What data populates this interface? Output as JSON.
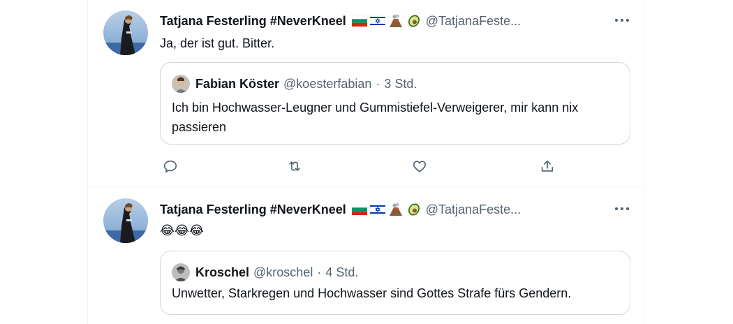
{
  "tweets": [
    {
      "name": "Tatjana Festerling #NeverKneel",
      "handle": "@TatjanaFeste...",
      "text": "Ja, der ist gut. Bitter.",
      "quote": {
        "name": "Fabian Köster",
        "handle": "@koesterfabian",
        "sep": "·",
        "time": "3 Std.",
        "text": "Ich bin Hochwasser-Leugner und Gummistiefel-Verweigerer, mir kann nix passieren"
      }
    },
    {
      "name": "Tatjana Festerling #NeverKneel",
      "handle": "@TatjanaFeste...",
      "text": "😂😂😂",
      "quote": {
        "name": "Kroschel",
        "handle": "@kroschel",
        "sep": "·",
        "time": "4 Std.",
        "text": "Unwetter, Starkregen und Hochwasser sind Gottes Strafe fürs Gendern."
      }
    }
  ],
  "icons": {
    "flag_1": "bulgaria-flag-icon",
    "flag_2": "israel-flag-icon",
    "emoji_1": "volcano-icon",
    "emoji_2": "avocado-icon",
    "reply": "reply-icon",
    "retweet": "retweet-icon",
    "like": "like-icon",
    "share": "share-icon",
    "more": "more-options-icon"
  },
  "colors": {
    "text": "#0f1419",
    "secondary": "#536471",
    "border": "#cfd9de",
    "divider": "#eff3f4"
  }
}
